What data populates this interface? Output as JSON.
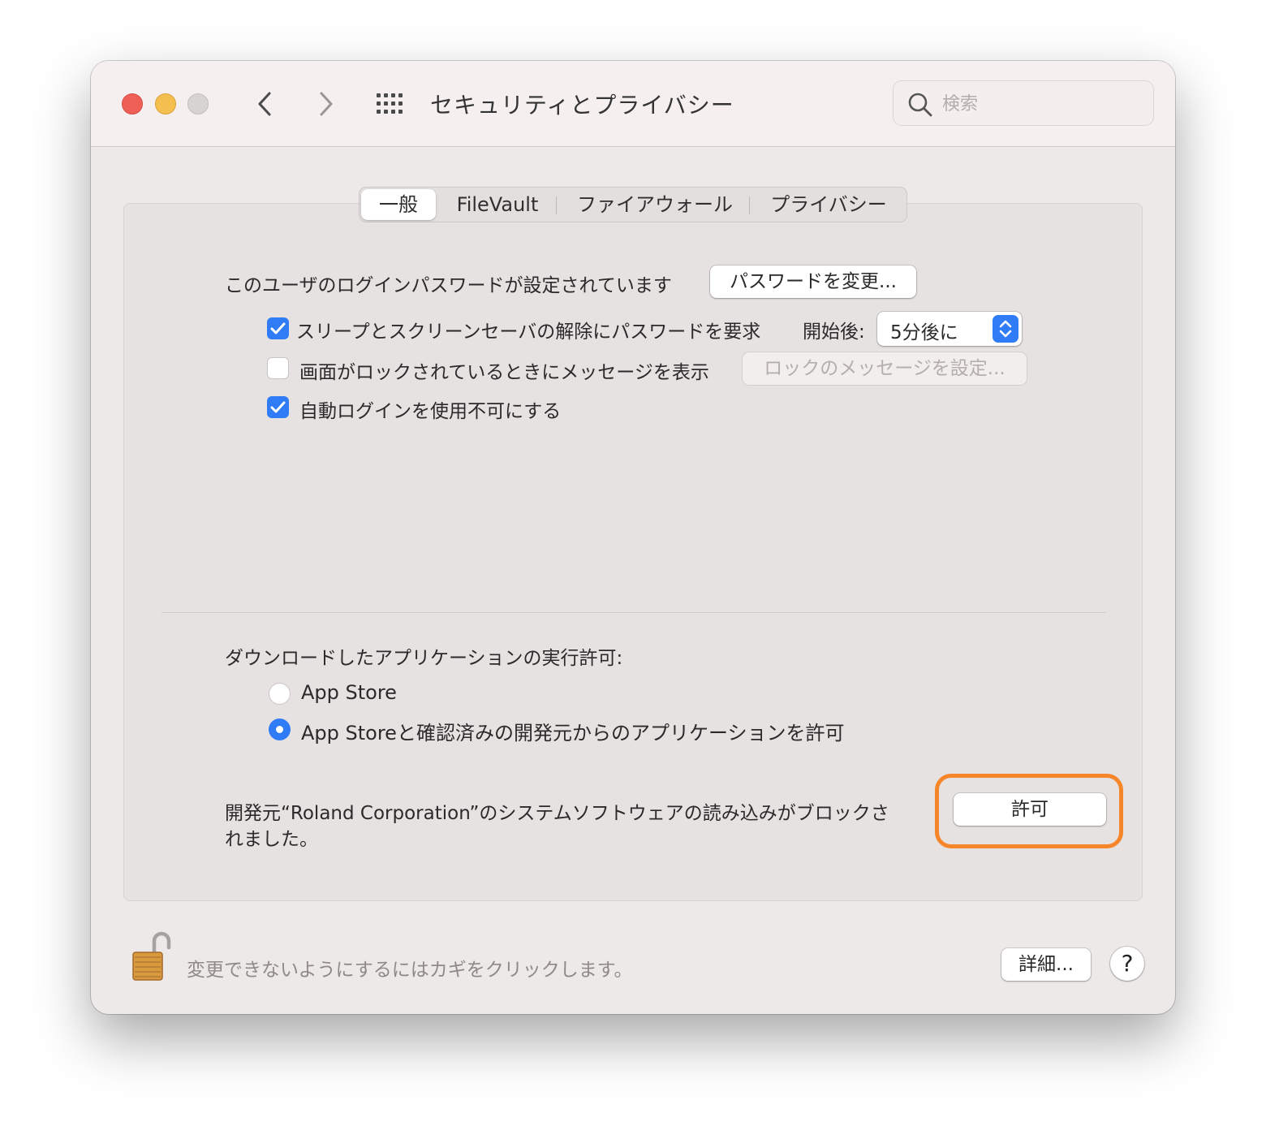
{
  "window": {
    "title": "セキュリティとプライバシー",
    "search_placeholder": "検索"
  },
  "tabs": [
    {
      "label": "一般",
      "active": true
    },
    {
      "label": "FileVault",
      "active": false
    },
    {
      "label": "ファイアウォール",
      "active": false
    },
    {
      "label": "プライバシー",
      "active": false
    }
  ],
  "general": {
    "password_text": "このユーザのログインパスワードが設定されています",
    "change_password_button": "パスワードを変更...",
    "require_password_label": "スリープとスクリーンセーバの解除にパスワードを要求",
    "require_password_checked": true,
    "after_label": "開始後:",
    "after_value": "5分後に",
    "lock_message_label": "画面がロックされているときにメッセージを表示",
    "lock_message_checked": false,
    "set_lock_message_button": "ロックのメッセージを設定...",
    "disable_auto_login_label": "自動ログインを使用不可にする",
    "disable_auto_login_checked": true
  },
  "downloads": {
    "heading": "ダウンロードしたアプリケーションの実行許可:",
    "options": [
      {
        "label": "App Store",
        "selected": false
      },
      {
        "label": "App Storeと確認済みの開発元からのアプリケーションを許可",
        "selected": true
      }
    ],
    "blocked_message_line1": "開発元“Roland Corporation”のシステムソフトウェアの読み込みがブロックさ",
    "blocked_message_line2": "れました。",
    "allow_button": "許可"
  },
  "footer": {
    "lock_text": "変更できないようにするにはカギをクリックします。",
    "advanced_button": "詳細...",
    "help_button": "?"
  },
  "colors": {
    "accent": "#2f7cf6",
    "highlight": "#f7862a",
    "close": "#ed5f57",
    "minimize": "#f4bf4f"
  }
}
